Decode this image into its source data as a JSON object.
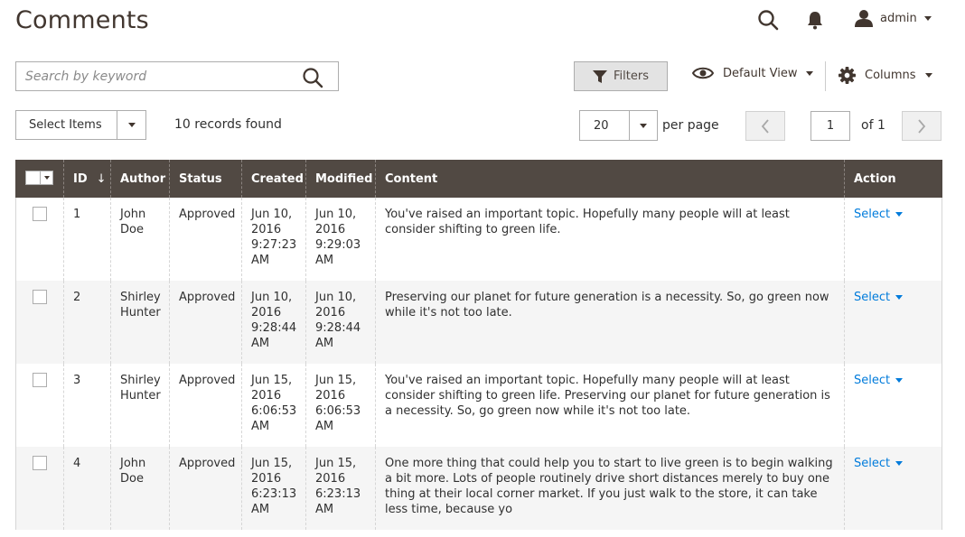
{
  "page": {
    "title": "Comments"
  },
  "header": {
    "user_name": "admin"
  },
  "search": {
    "placeholder": "Search by keyword",
    "value": ""
  },
  "toolbar": {
    "filters_label": "Filters",
    "view_label": "Default View",
    "columns_label": "Columns",
    "mass_action_label": "Select Items",
    "records_found": "10 records found",
    "per_page_value": "20",
    "per_page_label": "per page",
    "current_page": "1",
    "of_pages": "of 1"
  },
  "grid": {
    "columns": {
      "id": "ID",
      "author": "Author",
      "status": "Status",
      "created": "Created",
      "modified": "Modified",
      "content": "Content",
      "action": "Action"
    },
    "sort_indicator": "↓",
    "rows": [
      {
        "id": "1",
        "author": "John Doe",
        "status": "Approved",
        "created": "Jun 10, 2016 9:27:23 AM",
        "modified": "Jun 10, 2016 9:29:03 AM",
        "content": "You've raised an important topic. Hopefully many people will at least consider shifting to green life.",
        "action": "Select"
      },
      {
        "id": "2",
        "author": "Shirley Hunter",
        "status": "Approved",
        "created": "Jun 10, 2016 9:28:44 AM",
        "modified": "Jun 10, 2016 9:28:44 AM",
        "content": "Preserving our planet for future generation is a necessity. So, go green now while it's not too late.",
        "action": "Select"
      },
      {
        "id": "3",
        "author": "Shirley Hunter",
        "status": "Approved",
        "created": "Jun 15, 2016 6:06:53 AM",
        "modified": "Jun 15, 2016 6:06:53 AM",
        "content": "You've raised an important topic. Hopefully many people will at least consider shifting to green life. Preserving our planet for future generation is a necessity. So, go green now while it's not too late.",
        "action": "Select"
      },
      {
        "id": "4",
        "author": "John Doe",
        "status": "Approved",
        "created": "Jun 15, 2016 6:23:13 AM",
        "modified": "Jun 15, 2016 6:23:13 AM",
        "content": "One more thing that could help you to start to live green is to begin walking a bit more. Lots of people routinely drive short distances merely to buy one thing at their local corner market. If you just walk to the store, it can take less time, because yo",
        "action": "Select"
      }
    ]
  }
}
